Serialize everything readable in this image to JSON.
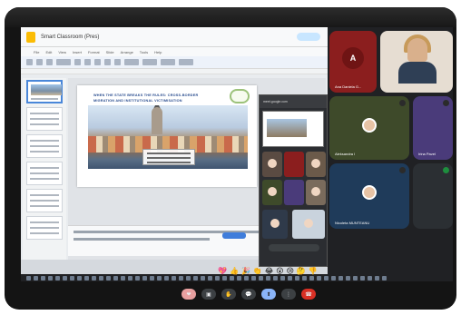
{
  "slides_app": {
    "title": "Smart Classroom (Pres)",
    "menu": [
      "File",
      "Edit",
      "View",
      "Insert",
      "Format",
      "Slide",
      "Arrange",
      "Tools",
      "Help"
    ],
    "slide_heading": "WHEN THE STATE BREAKS THE RULES: CROSS-BORDER MIGRATION AND INSTITUTIONAL VICTIMISATION"
  },
  "popup": {
    "address": "meet.google.com"
  },
  "meet": {
    "participants": [
      {
        "name": "Ana Daniela G...",
        "initial": "A",
        "type": "initial",
        "color": "#8b1e1e"
      },
      {
        "name": "",
        "type": "video"
      },
      {
        "name": "Aleksandra I",
        "type": "avatar",
        "color": "#3e4a2a"
      },
      {
        "name": "Irina Pavel",
        "type": "avatar",
        "color": "#4a3b7a"
      },
      {
        "name": "Nicoleta MUNTEANU",
        "type": "avatar",
        "color": "#1f3b5a"
      },
      {
        "name": "",
        "type": "avatar",
        "color": "#2b2f33"
      }
    ]
  },
  "reactions": [
    "💖",
    "👍",
    "🎉",
    "👏",
    "😂",
    "😮",
    "😢",
    "🤔",
    "👎"
  ],
  "controls": [
    {
      "icon": "❤",
      "style": "pink"
    },
    {
      "icon": "▣",
      "style": "normal"
    },
    {
      "icon": "✋",
      "style": "normal"
    },
    {
      "icon": "💬",
      "style": "normal"
    },
    {
      "icon": "⬆",
      "style": "active"
    },
    {
      "icon": "⋮",
      "style": "normal"
    },
    {
      "icon": "☎",
      "style": "red"
    }
  ]
}
